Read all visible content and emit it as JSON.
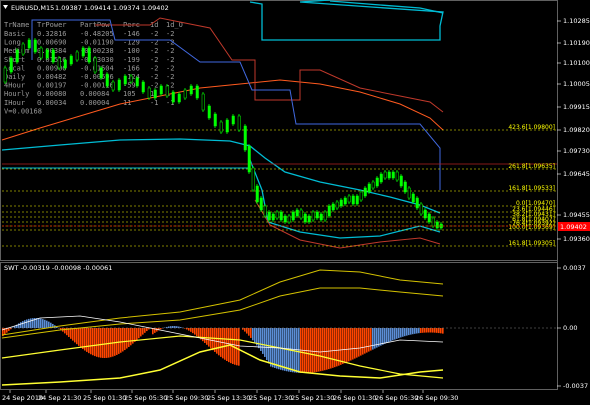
{
  "header": {
    "symbol_tf": "EURUSD,M15",
    "ohlc": "1.09387 1.09414 1.09374 1.09402",
    "arrow_icon": "down-triangle-icon"
  },
  "info_table": {
    "columns": [
      "TrName",
      "TrPower",
      "PartPow",
      "Perc",
      "1d",
      "1d_O"
    ],
    "rows": [
      [
        "Basic",
        "0.32816",
        "-0.48205",
        "-146",
        "-2",
        "-2"
      ],
      [
        "Long",
        "0.00690",
        "-0.01190",
        "-129",
        "-2",
        "-2"
      ],
      [
        "Medium",
        "0.00384",
        "-0.00238",
        "-100",
        "-2",
        "-2"
      ],
      [
        "Short",
        "0.01516",
        "-0.03030",
        "-199",
        "-2",
        "-2"
      ],
      [
        "Local",
        "0.00906",
        "-0.01504",
        "-166",
        "-2",
        "-2"
      ],
      [
        "Daily",
        "0.00482",
        "-0.00596",
        "-124",
        "-2",
        "-2"
      ],
      [
        "4Hour",
        "0.00197",
        "-0.00116",
        "-59",
        "-2",
        "-2"
      ],
      [
        "Hourly",
        "0.00080",
        "0.00084",
        "105",
        "1",
        "1"
      ],
      [
        "IHour",
        "0.00034",
        "0.00004",
        "11",
        "-1",
        "-1"
      ]
    ],
    "footer": "V=0.00168"
  },
  "price_axis": {
    "ticks": [
      "1.10285",
      "1.10190",
      "1.10100",
      "1.10005",
      "1.09915",
      "1.09820",
      "1.09730",
      "1.09645",
      "1.09455",
      "1.09360"
    ],
    "current_price": "1.09402",
    "current_color": "#ff0000"
  },
  "fib_levels": [
    {
      "label": "423.6[1.09800]"
    },
    {
      "label": "261.8[1.09635]"
    },
    {
      "label": "161.8[1.09533]"
    },
    {
      "label": "0.0[1.09470]"
    },
    {
      "label": "23.6[1.09446]"
    },
    {
      "label": "38.2[1.09431]"
    },
    {
      "label": "61.8[1.09407]"
    },
    {
      "label": "76.4[1.09392]"
    },
    {
      "label": "100.0[1.09369]"
    },
    {
      "label": "161.8[1.09305]"
    }
  ],
  "sub_window": {
    "title": "SWT -0.00319 -0.00098 -0.00061",
    "ticks": [
      "0.0037",
      "0.00",
      "-0.0037"
    ]
  },
  "time_axis": [
    "24 Sep 2019",
    "24 Sep 21:30",
    "25 Sep 01:30",
    "25 Sep 05:30",
    "25 Sep 09:30",
    "25 Sep 13:30",
    "25 Sep 17:30",
    "25 Sep 21:30",
    "26 Sep 01:30",
    "26 Sep 05:30",
    "26 Sep 09:30"
  ],
  "colors": {
    "background": "#000000",
    "candle_bull": "#00ff00",
    "upper_band": "#00bcd4",
    "fib": "#ffff00",
    "histogram_pos": "#5b8ed6",
    "histogram_neg": "#ff4500",
    "current_price": "#ff0000"
  }
}
